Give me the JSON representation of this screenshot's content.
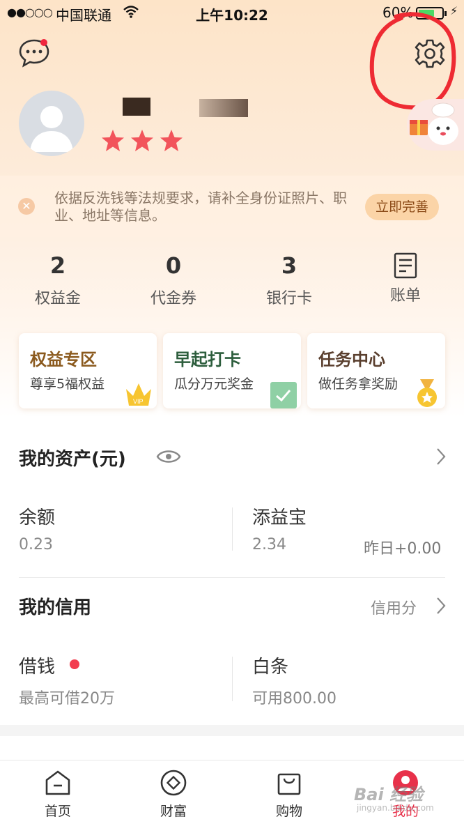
{
  "status_bar": {
    "signal": "●●○○○",
    "carrier": "中国联通",
    "time": "上午10:22",
    "battery": "60%"
  },
  "profile": {
    "stars": 3
  },
  "notice": {
    "text": "依据反洗钱等法规要求，请补全身份证照片、职业、地址等信息。",
    "button": "立即完善"
  },
  "stats": [
    {
      "value": "2",
      "label": "权益金"
    },
    {
      "value": "0",
      "label": "代金券"
    },
    {
      "value": "3",
      "label": "银行卡"
    },
    {
      "label": "账单"
    }
  ],
  "cards": [
    {
      "title": "权益专区",
      "subtitle": "尊享5福权益",
      "badge": "VIP",
      "color": "#8b5a1e"
    },
    {
      "title": "早起打卡",
      "subtitle": "瓜分万元奖金",
      "color": "#2c5d3c"
    },
    {
      "title": "任务中心",
      "subtitle": "做任务拿奖励",
      "color": "#5a3f2e"
    }
  ],
  "assets": {
    "title": "我的资产(元)",
    "balance_label": "余额",
    "balance_value": "0.23",
    "fund_label": "添益宝",
    "fund_value": "2.34",
    "fund_yesterday": "昨日+0.00"
  },
  "credit": {
    "title": "我的信用",
    "score_link": "信用分",
    "borrow_label": "借钱",
    "borrow_value": "最高可借20万",
    "baitiao_label": "白条",
    "baitiao_value": "可用800.00"
  },
  "tabbar": [
    {
      "label": "首页",
      "icon": "home-icon"
    },
    {
      "label": "财富",
      "icon": "wealth-icon"
    },
    {
      "label": "购物",
      "icon": "shopping-bag-icon"
    },
    {
      "label": "我的",
      "icon": "profile-icon"
    }
  ],
  "watermark": {
    "text": "Bai 经验",
    "sub": "jingyan.baidu.com"
  },
  "colors": {
    "accent": "#e8314a",
    "brand_bg": "#fde4c8"
  }
}
